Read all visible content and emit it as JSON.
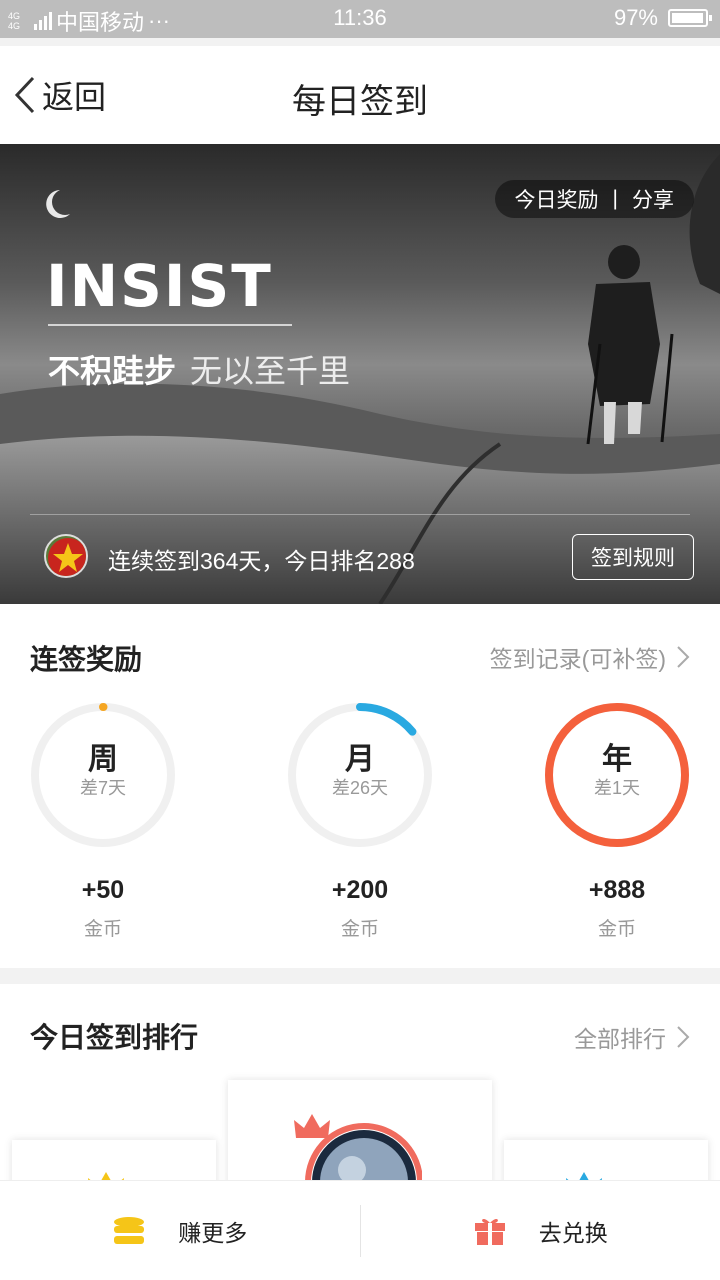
{
  "status_bar": {
    "network_small": "4G 4G",
    "carrier": "中国移动",
    "more": "···",
    "time": "11:36",
    "battery_text": "97%",
    "battery_level_percent": 97
  },
  "nav": {
    "back_label": "返回",
    "title": "每日签到"
  },
  "banner": {
    "today_reward": "今日奖励",
    "separator": "|",
    "share": "分享",
    "headline": "INSIST",
    "motto_bold": "不积跬步",
    "motto_rest": "无以至千里",
    "streak_text": "连续签到364天，今日排名288",
    "rules_button": "签到规则"
  },
  "rewards": {
    "title": "连签奖励",
    "record_link": "签到记录(可补签)",
    "items": [
      {
        "label": "周",
        "remaining": "差7天",
        "amount": "+50",
        "unit": "金币",
        "progress_fraction": 0.0,
        "color": "#f5a623"
      },
      {
        "label": "月",
        "remaining": "差26天",
        "amount": "+200",
        "unit": "金币",
        "progress_fraction": 0.14,
        "color": "#29a9e1"
      },
      {
        "label": "年",
        "remaining": "差1天",
        "amount": "+888",
        "unit": "金币",
        "progress_fraction": 1.0,
        "color": "#f4603c"
      }
    ],
    "track_color": "#f0f0f0"
  },
  "ranking": {
    "title": "今日签到排行",
    "all_link": "全部排行"
  },
  "bottom_bar": {
    "earn_more": "赚更多",
    "exchange": "去兑换",
    "coin_color": "#f5c518",
    "gift_color": "#f06b5e"
  }
}
